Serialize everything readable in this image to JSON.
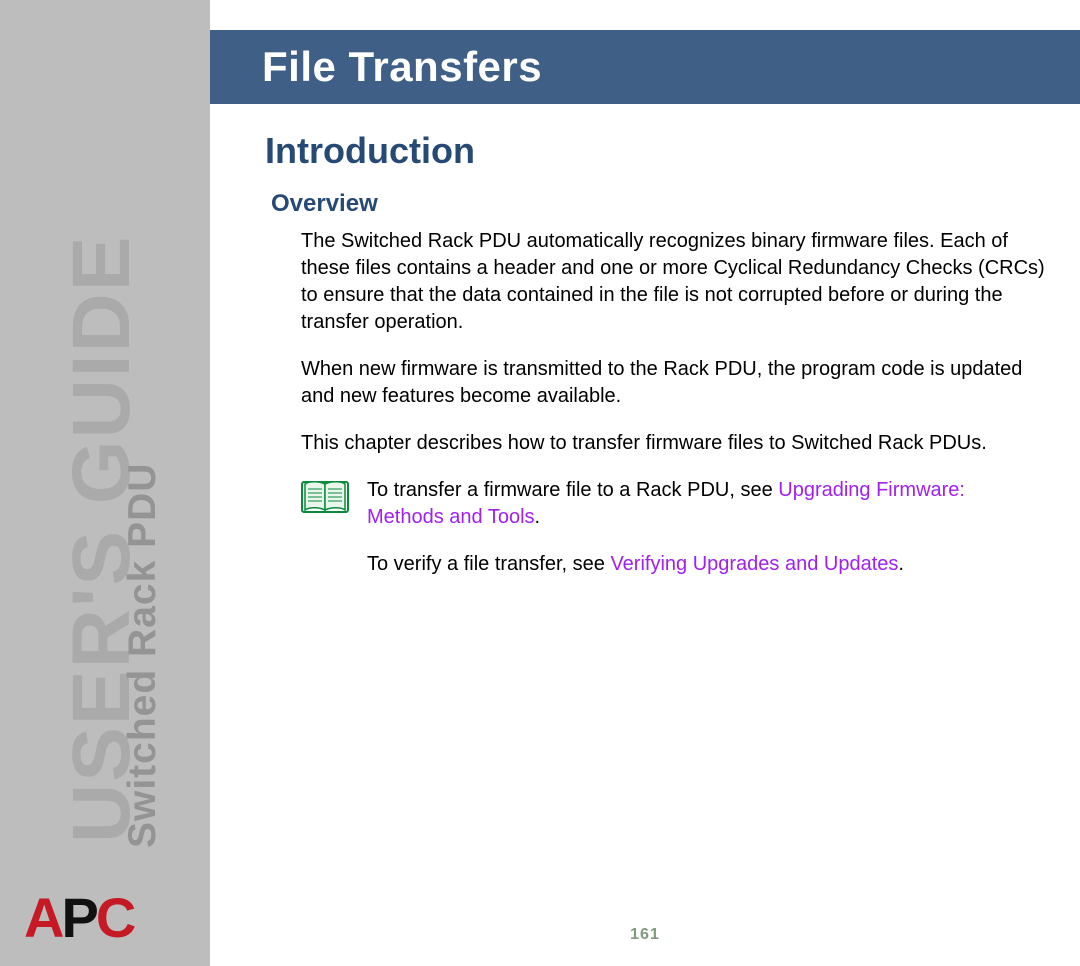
{
  "sidebar": {
    "guide_label": "USER'S GUIDE",
    "subtitle": "Switched Rack PDU",
    "logo": {
      "a": "A",
      "p": "P",
      "c": "C"
    }
  },
  "header": {
    "title": "File Transfers"
  },
  "content": {
    "section_title": "Introduction",
    "subsection_title": "Overview",
    "p1": "The Switched Rack PDU automatically recognizes binary firmware files. Each of these files contains a header and one or more Cyclical Redundancy Checks (CRCs) to ensure that the data contained in the file is not corrupted before or during the transfer operation.",
    "p2": "When new firmware is transmitted to the Rack PDU, the program code is updated and new features become available.",
    "p3": "This chapter describes how to transfer firmware files to Switched Rack PDUs.",
    "note1_pre": "To transfer a firmware file to a Rack PDU, see ",
    "note1_link": "Upgrading Firmware: Methods and Tools",
    "note1_post": ".",
    "note2_pre": "To verify a file transfer, see ",
    "note2_link": "Verifying Upgrades and Updates",
    "note2_post": "."
  },
  "page_number": "161"
}
